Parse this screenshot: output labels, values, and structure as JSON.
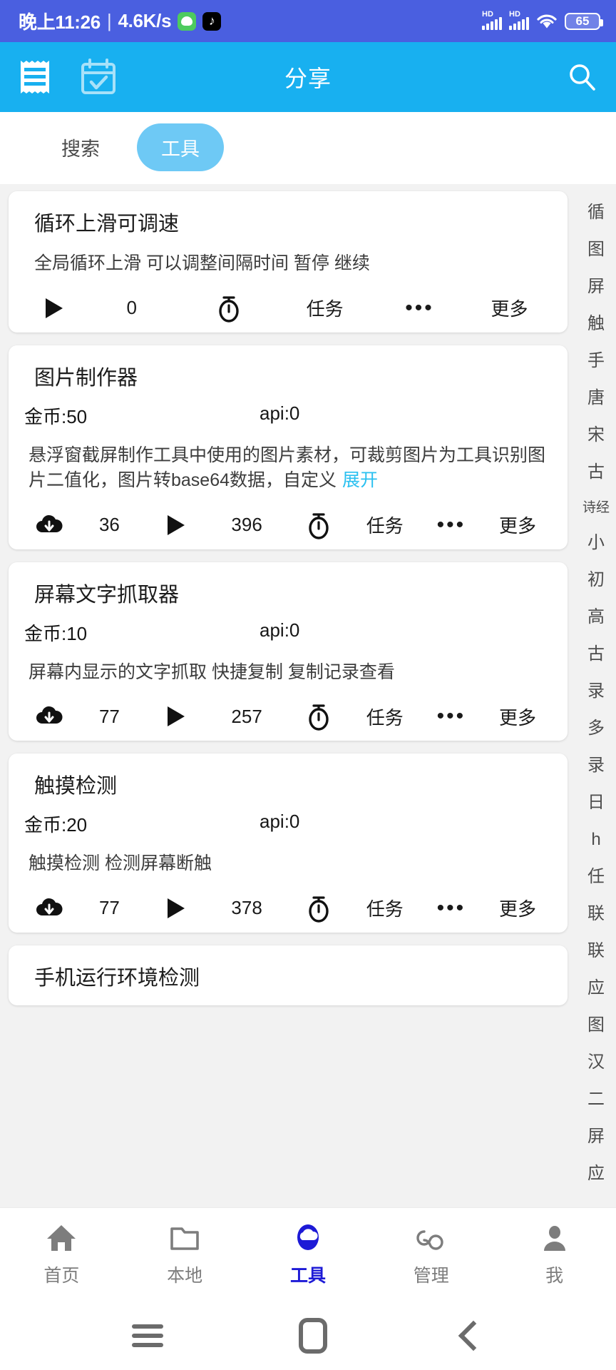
{
  "statusbar": {
    "time": "晚上11:26",
    "separator": "|",
    "netspeed": "4.6K/s",
    "hd_label_1": "HD",
    "hd_label_2": "HD",
    "battery": "65",
    "bg_color": "#4a5fe0"
  },
  "appbar": {
    "title": "分享",
    "bg_color": "#18b0f0"
  },
  "tabs": {
    "items": [
      {
        "label": "搜索",
        "active": false
      },
      {
        "label": "工具",
        "active": true
      }
    ],
    "active_color": "#6ec9f5"
  },
  "cards": [
    {
      "title": "循环上滑可调速",
      "desc": "全局循环上滑 可以调整间隔时间 暂停 继续",
      "expand": "",
      "has_meta": false,
      "coin": "",
      "api": "",
      "actions": {
        "layout": "v1",
        "download": "",
        "play_count": "0",
        "task": "任务",
        "more": "更多"
      }
    },
    {
      "title": "图片制作器",
      "desc": "悬浮窗截屏制作工具中使用的图片素材，可裁剪图片为工具识别图片二值化，图片转base64数据，自定义",
      "expand": "展开",
      "has_meta": true,
      "coin": "金币:50",
      "api": "api:0",
      "actions": {
        "layout": "v2",
        "download": "36",
        "play_count": "396",
        "task": "任务",
        "more": "更多"
      }
    },
    {
      "title": "屏幕文字抓取器",
      "desc": "屏幕内显示的文字抓取 快捷复制 复制记录查看",
      "expand": "",
      "has_meta": true,
      "coin": "金币:10",
      "api": "api:0",
      "actions": {
        "layout": "v2",
        "download": "77",
        "play_count": "257",
        "task": "任务",
        "more": "更多"
      }
    },
    {
      "title": "触摸检测",
      "desc": "触摸检测 检测屏幕断触",
      "expand": "",
      "has_meta": true,
      "coin": "金币:20",
      "api": "api:0",
      "actions": {
        "layout": "v2",
        "download": "77",
        "play_count": "378",
        "task": "任务",
        "more": "更多"
      }
    },
    {
      "title": "手机运行环境检测",
      "desc": "",
      "expand": "",
      "has_meta": false,
      "coin": "",
      "api": "",
      "actions": null
    }
  ],
  "rail": {
    "items": [
      "循",
      "图",
      "屏",
      "触",
      "手",
      "唐",
      "宋",
      "古",
      "诗经",
      "小",
      "初",
      "高",
      "古",
      "录",
      "多",
      "录",
      "日",
      "h",
      "任",
      "联",
      "联",
      "应",
      "图",
      "汉",
      "二",
      "屏",
      "应"
    ]
  },
  "bottomnav": {
    "items": [
      {
        "label": "首页",
        "icon": "home-icon",
        "active": false
      },
      {
        "label": "本地",
        "icon": "folder-icon",
        "active": false
      },
      {
        "label": "工具",
        "icon": "cloud-icon",
        "active": true
      },
      {
        "label": "管理",
        "icon": "infinity-icon",
        "active": false
      },
      {
        "label": "我",
        "icon": "person-icon",
        "active": false
      }
    ],
    "active_color": "#1d1ad6"
  }
}
